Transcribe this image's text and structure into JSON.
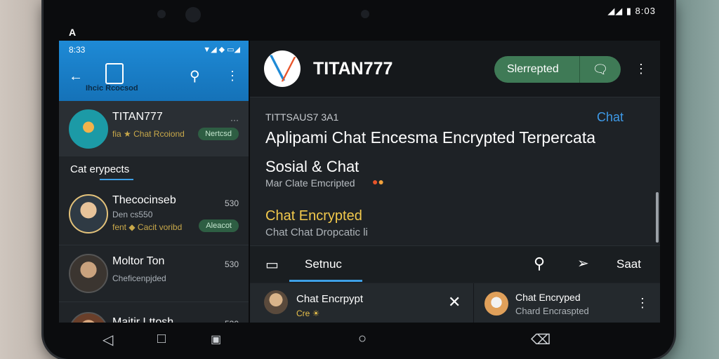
{
  "device": {
    "status": "◢◢ ▮ 8:03",
    "logo": "A"
  },
  "left_panel": {
    "statusbar": {
      "time": "8:33",
      "icons": "▼◢ ◆ ▭◢"
    },
    "header": {
      "subtitle": "Ihcic Rcocsod"
    },
    "pinned_chat": {
      "name": "TITAN777",
      "sub": "fia ★ Chat Rcoiond",
      "badge": "Nertcsd",
      "menu": "···"
    },
    "section_label": "Cat erypects",
    "chats": [
      {
        "name": "Thecocinseb",
        "line1": "Den cs550",
        "line2": "fent ◆ Cacit voribd",
        "time": "530",
        "badge": "Aleacot"
      },
      {
        "name": "Moltor Ton",
        "line1": "Cheficenpjded",
        "time": "530"
      },
      {
        "name": "Maitir Lttosh",
        "time": "530"
      }
    ]
  },
  "right_panel": {
    "header": {
      "title": "TITAN777",
      "pill_label": "Slerrepted"
    },
    "kicker": "TITTSAUS7 3A1",
    "chat_link": "Chat",
    "main_title": "Aplipami Chat Encesma Encrypted Terpercata",
    "sosial": "Sosial & Chat",
    "small_line": "Mar Clate Emcripted",
    "yellow_line": "Chat Encrypted",
    "grey_line": "Chat Chat Dropcatic li",
    "tabs": {
      "active_label": "Setnuc",
      "start_label": "Saat"
    },
    "bottom_left": {
      "name": "Chat Encrpypt",
      "sub": "Cre ☀"
    },
    "bottom_right": {
      "name": "Chat Encryped",
      "sub": "Chard Encraspted"
    }
  },
  "icons": {
    "back": "back-arrow-icon",
    "clipboard": "clipboard-icon",
    "search": "search-icon",
    "more": "more-vertical-icon",
    "chat": "chat-bubble-icon",
    "send": "send-icon",
    "close": "close-icon",
    "nav_back": "triangle-back-icon",
    "nav_home": "circle-home-icon",
    "nav_recent": "square-recent-icon"
  },
  "colors": {
    "accent_blue": "#1e8ad6",
    "pill_green": "#3f7a56",
    "highlight_yellow": "#f2c94c"
  }
}
